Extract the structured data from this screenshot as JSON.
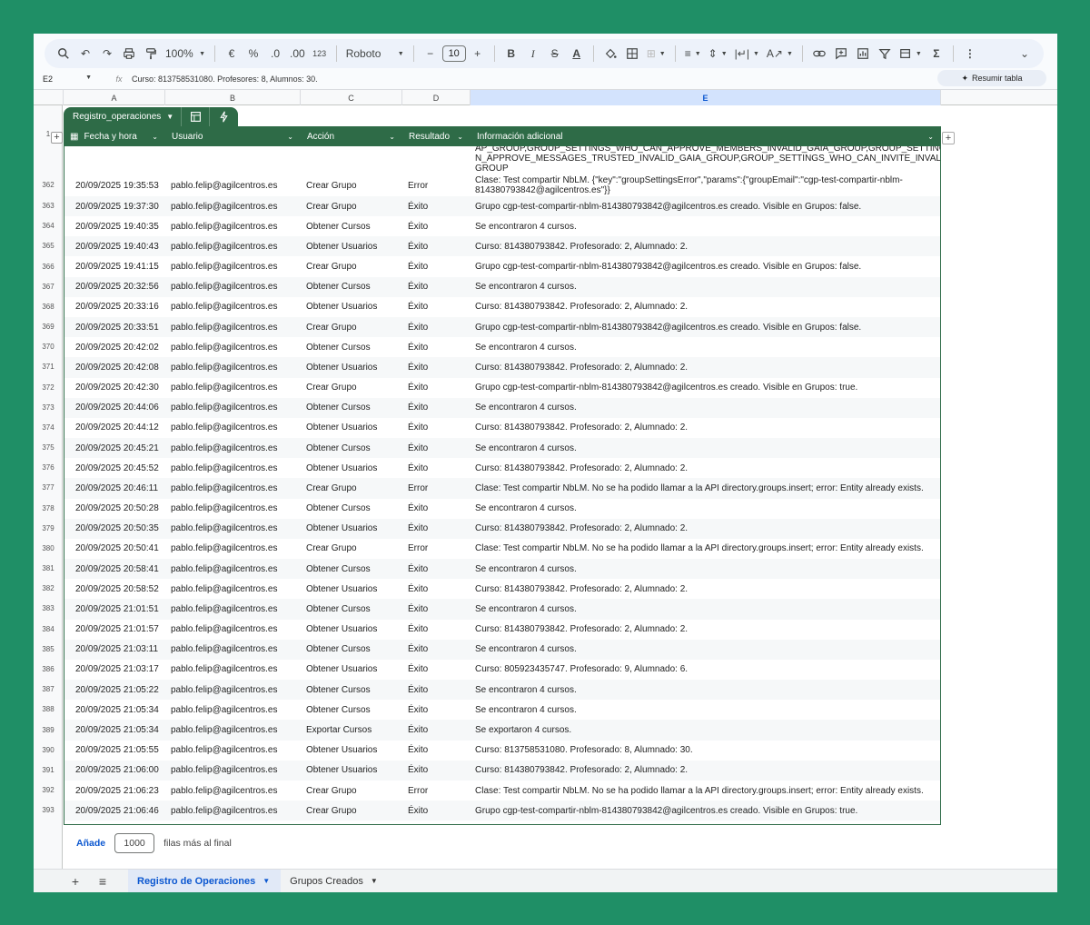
{
  "toolbar": {
    "zoom": "100%",
    "currency": "€",
    "percent": "%",
    "dec_decrease": ".0",
    "dec_increase": ".00",
    "number_format": "123",
    "font": "Roboto",
    "font_size": "10"
  },
  "formula_bar": {
    "cell_ref": "E2",
    "value": "Curso: 813758531080. Profesores: 8, Alumnos: 30.",
    "summarize_label": "Resumir tabla"
  },
  "columns": [
    "A",
    "B",
    "C",
    "D",
    "E"
  ],
  "table": {
    "name": "Registro_operaciones",
    "headers": [
      "Fecha y hora",
      "Usuario",
      "Acción",
      "Resultado",
      "Información adicional"
    ],
    "header_row_number": "1",
    "partial_row": {
      "info": "AP_GROUP,GROUP_SETTINGS_WHO_CAN_APPROVE_MEMBERS_INVALID_GAIA_GROUP,GROUP_SETTINGS_WHO_CA N_APPROVE_MESSAGES_TRUSTED_INVALID_GAIA_GROUP,GROUP_SETTINGS_WHO_CAN_INVITE_INVALID_GAIA_ GROUP"
    },
    "rows": [
      {
        "n": "362",
        "date": "20/09/2025 19:35:53",
        "user": "pablo.felip@agilcentros.es",
        "action": "Crear Grupo",
        "result": "Error",
        "info": "Clase: Test compartir NbLM. {\"key\":\"groupSettingsError\",\"params\":{\"groupEmail\":\"cgp-test-compartir-nblm-814380793842@agilcentros.es\"}}"
      },
      {
        "n": "363",
        "date": "20/09/2025 19:37:30",
        "user": "pablo.felip@agilcentros.es",
        "action": "Crear Grupo",
        "result": "Éxito",
        "info": "Grupo cgp-test-compartir-nblm-814380793842@agilcentros.es creado. Visible en Grupos: false."
      },
      {
        "n": "364",
        "date": "20/09/2025 19:40:35",
        "user": "pablo.felip@agilcentros.es",
        "action": "Obtener Cursos",
        "result": "Éxito",
        "info": "Se encontraron 4 cursos."
      },
      {
        "n": "365",
        "date": "20/09/2025 19:40:43",
        "user": "pablo.felip@agilcentros.es",
        "action": "Obtener Usuarios",
        "result": "Éxito",
        "info": "Curso: 814380793842. Profesorado: 2, Alumnado: 2."
      },
      {
        "n": "366",
        "date": "20/09/2025 19:41:15",
        "user": "pablo.felip@agilcentros.es",
        "action": "Crear Grupo",
        "result": "Éxito",
        "info": "Grupo cgp-test-compartir-nblm-814380793842@agilcentros.es creado. Visible en Grupos: false."
      },
      {
        "n": "367",
        "date": "20/09/2025 20:32:56",
        "user": "pablo.felip@agilcentros.es",
        "action": "Obtener Cursos",
        "result": "Éxito",
        "info": "Se encontraron 4 cursos."
      },
      {
        "n": "368",
        "date": "20/09/2025 20:33:16",
        "user": "pablo.felip@agilcentros.es",
        "action": "Obtener Usuarios",
        "result": "Éxito",
        "info": "Curso: 814380793842. Profesorado: 2, Alumnado: 2."
      },
      {
        "n": "369",
        "date": "20/09/2025 20:33:51",
        "user": "pablo.felip@agilcentros.es",
        "action": "Crear Grupo",
        "result": "Éxito",
        "info": "Grupo cgp-test-compartir-nblm-814380793842@agilcentros.es creado. Visible en Grupos: false."
      },
      {
        "n": "370",
        "date": "20/09/2025 20:42:02",
        "user": "pablo.felip@agilcentros.es",
        "action": "Obtener Cursos",
        "result": "Éxito",
        "info": "Se encontraron 4 cursos."
      },
      {
        "n": "371",
        "date": "20/09/2025 20:42:08",
        "user": "pablo.felip@agilcentros.es",
        "action": "Obtener Usuarios",
        "result": "Éxito",
        "info": "Curso: 814380793842. Profesorado: 2, Alumnado: 2."
      },
      {
        "n": "372",
        "date": "20/09/2025 20:42:30",
        "user": "pablo.felip@agilcentros.es",
        "action": "Crear Grupo",
        "result": "Éxito",
        "info": "Grupo cgp-test-compartir-nblm-814380793842@agilcentros.es creado. Visible en Grupos: true."
      },
      {
        "n": "373",
        "date": "20/09/2025 20:44:06",
        "user": "pablo.felip@agilcentros.es",
        "action": "Obtener Cursos",
        "result": "Éxito",
        "info": "Se encontraron 4 cursos."
      },
      {
        "n": "374",
        "date": "20/09/2025 20:44:12",
        "user": "pablo.felip@agilcentros.es",
        "action": "Obtener Usuarios",
        "result": "Éxito",
        "info": "Curso: 814380793842. Profesorado: 2, Alumnado: 2."
      },
      {
        "n": "375",
        "date": "20/09/2025 20:45:21",
        "user": "pablo.felip@agilcentros.es",
        "action": "Obtener Cursos",
        "result": "Éxito",
        "info": "Se encontraron 4 cursos."
      },
      {
        "n": "376",
        "date": "20/09/2025 20:45:52",
        "user": "pablo.felip@agilcentros.es",
        "action": "Obtener Usuarios",
        "result": "Éxito",
        "info": "Curso: 814380793842. Profesorado: 2, Alumnado: 2."
      },
      {
        "n": "377",
        "date": "20/09/2025 20:46:11",
        "user": "pablo.felip@agilcentros.es",
        "action": "Crear Grupo",
        "result": "Error",
        "info": "Clase: Test compartir NbLM. No se ha podido llamar a la API directory.groups.insert; error: Entity already exists."
      },
      {
        "n": "378",
        "date": "20/09/2025 20:50:28",
        "user": "pablo.felip@agilcentros.es",
        "action": "Obtener Cursos",
        "result": "Éxito",
        "info": "Se encontraron 4 cursos."
      },
      {
        "n": "379",
        "date": "20/09/2025 20:50:35",
        "user": "pablo.felip@agilcentros.es",
        "action": "Obtener Usuarios",
        "result": "Éxito",
        "info": "Curso: 814380793842. Profesorado: 2, Alumnado: 2."
      },
      {
        "n": "380",
        "date": "20/09/2025 20:50:41",
        "user": "pablo.felip@agilcentros.es",
        "action": "Crear Grupo",
        "result": "Error",
        "info": "Clase: Test compartir NbLM. No se ha podido llamar a la API directory.groups.insert; error: Entity already exists."
      },
      {
        "n": "381",
        "date": "20/09/2025 20:58:41",
        "user": "pablo.felip@agilcentros.es",
        "action": "Obtener Cursos",
        "result": "Éxito",
        "info": "Se encontraron 4 cursos."
      },
      {
        "n": "382",
        "date": "20/09/2025 20:58:52",
        "user": "pablo.felip@agilcentros.es",
        "action": "Obtener Usuarios",
        "result": "Éxito",
        "info": "Curso: 814380793842. Profesorado: 2, Alumnado: 2."
      },
      {
        "n": "383",
        "date": "20/09/2025 21:01:51",
        "user": "pablo.felip@agilcentros.es",
        "action": "Obtener Cursos",
        "result": "Éxito",
        "info": "Se encontraron 4 cursos."
      },
      {
        "n": "384",
        "date": "20/09/2025 21:01:57",
        "user": "pablo.felip@agilcentros.es",
        "action": "Obtener Usuarios",
        "result": "Éxito",
        "info": "Curso: 814380793842. Profesorado: 2, Alumnado: 2."
      },
      {
        "n": "385",
        "date": "20/09/2025 21:03:11",
        "user": "pablo.felip@agilcentros.es",
        "action": "Obtener Cursos",
        "result": "Éxito",
        "info": "Se encontraron 4 cursos."
      },
      {
        "n": "386",
        "date": "20/09/2025 21:03:17",
        "user": "pablo.felip@agilcentros.es",
        "action": "Obtener Usuarios",
        "result": "Éxito",
        "info": "Curso: 805923435747. Profesorado: 9, Alumnado: 6."
      },
      {
        "n": "387",
        "date": "20/09/2025 21:05:22",
        "user": "pablo.felip@agilcentros.es",
        "action": "Obtener Cursos",
        "result": "Éxito",
        "info": "Se encontraron 4 cursos."
      },
      {
        "n": "388",
        "date": "20/09/2025 21:05:34",
        "user": "pablo.felip@agilcentros.es",
        "action": "Obtener Cursos",
        "result": "Éxito",
        "info": "Se encontraron 4 cursos."
      },
      {
        "n": "389",
        "date": "20/09/2025 21:05:34",
        "user": "pablo.felip@agilcentros.es",
        "action": "Exportar Cursos",
        "result": "Éxito",
        "info": "Se exportaron 4 cursos."
      },
      {
        "n": "390",
        "date": "20/09/2025 21:05:55",
        "user": "pablo.felip@agilcentros.es",
        "action": "Obtener Usuarios",
        "result": "Éxito",
        "info": "Curso: 813758531080. Profesorado: 8, Alumnado: 30."
      },
      {
        "n": "391",
        "date": "20/09/2025 21:06:00",
        "user": "pablo.felip@agilcentros.es",
        "action": "Obtener Usuarios",
        "result": "Éxito",
        "info": "Curso: 814380793842. Profesorado: 2, Alumnado: 2."
      },
      {
        "n": "392",
        "date": "20/09/2025 21:06:23",
        "user": "pablo.felip@agilcentros.es",
        "action": "Crear Grupo",
        "result": "Error",
        "info": "Clase: Test compartir NbLM. No se ha podido llamar a la API directory.groups.insert; error: Entity already exists."
      },
      {
        "n": "393",
        "date": "20/09/2025 21:06:46",
        "user": "pablo.felip@agilcentros.es",
        "action": "Crear Grupo",
        "result": "Éxito",
        "info": "Grupo cgp-test-compartir-nblm-814380793842@agilcentros.es creado. Visible en Grupos: true."
      }
    ]
  },
  "add_rows": {
    "button": "Añade",
    "count": "1000",
    "suffix": "filas más al final"
  },
  "sheets": {
    "active": "Registro de Operaciones",
    "other": "Grupos Creados"
  },
  "colors": {
    "accent": "#0b57d0",
    "table_header": "#2e6b47",
    "background": "#1f8f66"
  }
}
